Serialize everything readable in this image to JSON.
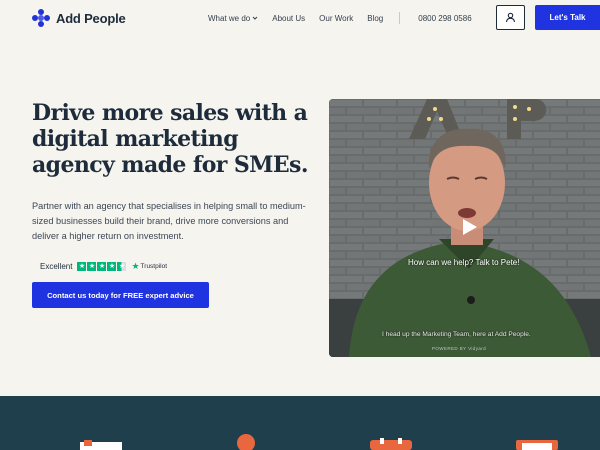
{
  "brand": {
    "name": "Add People",
    "accent": "#2033e0"
  },
  "nav": {
    "items": [
      {
        "label": "What we do",
        "has_dropdown": true
      },
      {
        "label": "About Us"
      },
      {
        "label": "Our Work"
      },
      {
        "label": "Blog"
      }
    ],
    "phone": "0800 298 0586",
    "account_icon": "user-icon",
    "cta_label": "Let's Talk"
  },
  "hero": {
    "headline": "Drive more sales with a digital marketing agency made for SMEs.",
    "lead": "Partner with an agency that specialises in helping small to medium-sized businesses build their brand, drive more conversions and deliver a higher return on investment.",
    "trust": {
      "rating_word": "Excellent",
      "stars": 4.5,
      "brand": "Trustpilot",
      "star_color": "#00b67a"
    },
    "cta_label": "Contact us today for FREE expert advice"
  },
  "video": {
    "caption": "How can we help? Talk to Pete!",
    "subtitle": "I head up the Marketing Team, here at Add People.",
    "powered": "POWERED BY  Vidyard",
    "play_icon": "play-icon"
  },
  "band": {
    "color": "#1f3f4d"
  }
}
